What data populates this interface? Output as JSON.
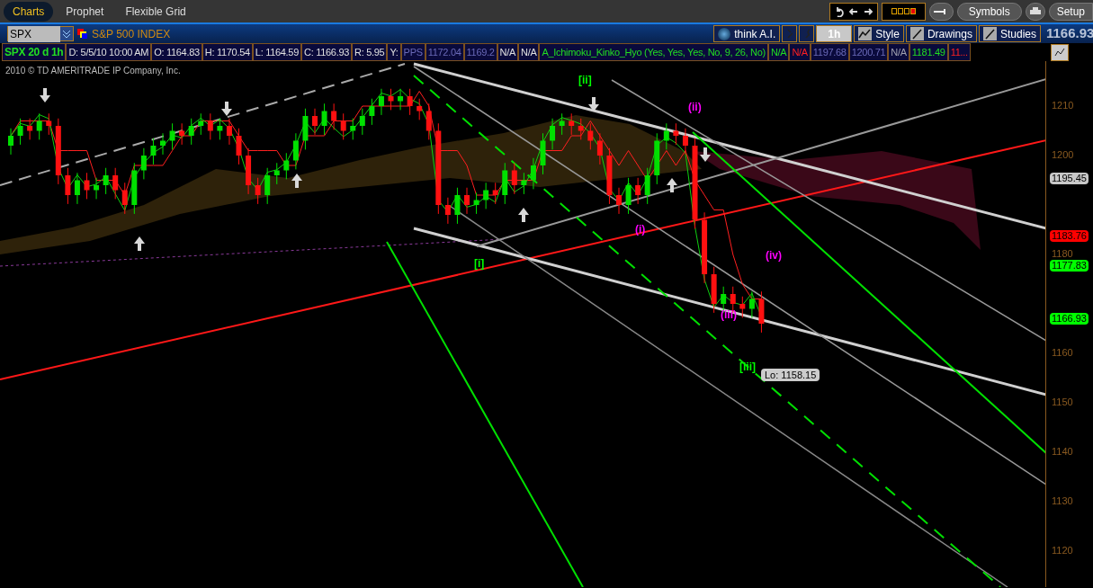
{
  "tabs": [
    {
      "label": "Charts",
      "selected": true
    },
    {
      "label": "Prophet",
      "selected": false
    },
    {
      "label": "Flexible Grid",
      "selected": false
    }
  ],
  "top_buttons": [
    "Symbols",
    "Setup"
  ],
  "symbol": {
    "value": "SPX",
    "description": "S&P 500 INDEX"
  },
  "chart_toolbar": [
    {
      "kind": "ai",
      "label": "think A.I."
    },
    {
      "kind": "tool"
    },
    {
      "kind": "tool2"
    },
    {
      "kind": "interval",
      "label": "1h"
    },
    {
      "kind": "style",
      "label": "Style"
    },
    {
      "kind": "drawings",
      "label": "Drawings"
    },
    {
      "kind": "studies",
      "label": "Studies"
    }
  ],
  "last_price": "1166.93",
  "info_cells": [
    {
      "text": "SPX 20 d 1h",
      "kind": "symbol"
    },
    {
      "text": "D: 5/5/10 10:00 AM",
      "kind": "plain"
    },
    {
      "text": "O: 1164.83",
      "kind": "plain"
    },
    {
      "text": "H: 1170.54",
      "kind": "plain"
    },
    {
      "text": "L: 1164.59",
      "kind": "plain"
    },
    {
      "text": "C: 1166.93",
      "kind": "plain"
    },
    {
      "text": "R: 5.95",
      "kind": "plain"
    },
    {
      "text": "Y:",
      "kind": "plain"
    },
    {
      "text": "PPS",
      "kind": "dim"
    },
    {
      "text": "1172.04",
      "kind": "dim"
    },
    {
      "text": "1169.2",
      "kind": "dim"
    },
    {
      "text": "N/A",
      "kind": "plain"
    },
    {
      "text": "N/A",
      "kind": "plain"
    },
    {
      "text": "A_Ichimoku_Kinko_Hyo (Yes, Yes, Yes, No, 9, 26, No)",
      "kind": "up"
    },
    {
      "text": "N/A",
      "kind": "up"
    },
    {
      "text": "N/A",
      "kind": "down"
    },
    {
      "text": "1197.68",
      "kind": "dim"
    },
    {
      "text": "1200.71",
      "kind": "dim"
    },
    {
      "text": "N/A",
      "kind": "neutral"
    },
    {
      "text": "1181.49",
      "kind": "up"
    },
    {
      "text": "11...",
      "kind": "down"
    }
  ],
  "chart": {
    "copyright": "2010 © TD AMERITRADE IP Company, Inc.",
    "price_ticks": [
      "1210",
      "1200",
      "1180",
      "1160",
      "1150",
      "1140",
      "1130",
      "1120"
    ],
    "price_badges": [
      {
        "text": "1195.45",
        "color": "#c8c8c8"
      },
      {
        "text": "1183.76",
        "color": "#ff0000"
      },
      {
        "text": "1177.83",
        "color": "#00ff00"
      },
      {
        "text": "1166.93",
        "color": "#00ff00"
      }
    ],
    "wave_labels": [
      {
        "text": "[ii]",
        "color": "#00ff00"
      },
      {
        "text": "(ii)",
        "color": "#ff00ff"
      },
      {
        "text": "[i]",
        "color": "#00ff00"
      },
      {
        "text": "(i)",
        "color": "#ff00ff"
      },
      {
        "text": "(iv)",
        "color": "#ff00ff"
      },
      {
        "text": "(iii)",
        "color": "#ff00ff"
      },
      {
        "text": "[iii]",
        "color": "#00ff00"
      }
    ],
    "low_label": "Lo: 1158.15"
  }
}
